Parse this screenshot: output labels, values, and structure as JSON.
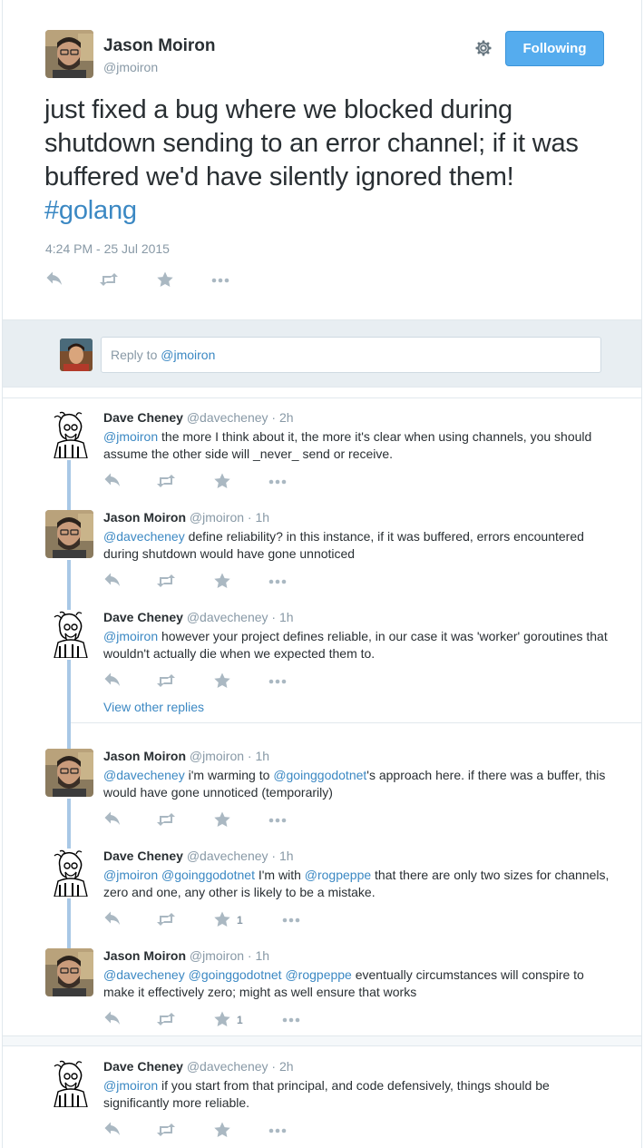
{
  "main_tweet": {
    "name": "Jason Moiron",
    "handle": "@jmoiron",
    "follow_label": "Following",
    "text_before": "just fixed a bug where we blocked during shutdown sending to an error channel;  if it was buffered we'd have silently ignored them! ",
    "hashtag": "#golang",
    "timestamp": "4:24 PM - 25 Jul 2015",
    "actions": [
      "reply-icon",
      "retweet-icon",
      "favorite-icon",
      "more-icon"
    ]
  },
  "reply_box": {
    "prefix": "Reply to ",
    "mention": "@jmoiron"
  },
  "threads": [
    {
      "tweets": [
        {
          "name": "Dave Cheney",
          "handle": "@davecheney",
          "time": "2h",
          "avatar": "dave-cheney-cartoon-avatar",
          "mentions": "@jmoiron",
          "text": " the more I think about it, the more it's clear when using channels, you should assume the other side will _never_ send or receive.",
          "fav_count": ""
        },
        {
          "name": "Jason Moiron",
          "handle": "@jmoiron",
          "time": "1h",
          "avatar": "jason-moiron-photo-avatar",
          "mentions": "@davecheney",
          "text": " define reliability?  in this instance, if it was buffered, errors encountered during shutdown would have gone unnoticed",
          "fav_count": ""
        },
        {
          "name": "Dave Cheney",
          "handle": "@davecheney",
          "time": "1h",
          "avatar": "dave-cheney-cartoon-avatar",
          "mentions": "@jmoiron",
          "text": " however your project defines reliable, in our case it was 'worker' goroutines that wouldn't actually die when we expected them to.",
          "fav_count": ""
        }
      ],
      "view_more": "View other replies"
    },
    {
      "tweets": [
        {
          "name": "Jason Moiron",
          "handle": "@jmoiron",
          "time": "1h",
          "avatar": "jason-moiron-photo-avatar",
          "mentions": "@davecheney",
          "text_parts": [
            " i'm warming to ",
            "@goinggodotnet",
            "'s approach here.  if there was a buffer, this would have gone unnoticed (temporarily)"
          ],
          "fav_count": ""
        },
        {
          "name": "Dave Cheney",
          "handle": "@davecheney",
          "time": "1h",
          "avatar": "dave-cheney-cartoon-avatar",
          "mentions": "@jmoiron @goinggodotnet",
          "text_parts": [
            " I'm with ",
            "@rogpeppe",
            " that there are only two sizes for channels, zero and one, any other is likely to be a mistake."
          ],
          "fav_count": "1"
        },
        {
          "name": "Jason Moiron",
          "handle": "@jmoiron",
          "time": "1h",
          "avatar": "jason-moiron-photo-avatar",
          "mentions": "@davecheney @goinggodotnet @rogpeppe",
          "text": " eventually circumstances will conspire to make it effectively zero; might as well ensure that works",
          "fav_count": "1"
        }
      ]
    },
    {
      "tweets": [
        {
          "name": "Dave Cheney",
          "handle": "@davecheney",
          "time": "2h",
          "avatar": "dave-cheney-cartoon-avatar",
          "mentions": "@jmoiron",
          "text": " if you start from that principal, and code defensively, things should be significantly more reliable.",
          "fav_count": ""
        }
      ]
    }
  ],
  "colors": {
    "link": "#3b88c3",
    "button": "#55acee",
    "thread_line": "#a8c8e6",
    "muted": "#8899a6"
  }
}
